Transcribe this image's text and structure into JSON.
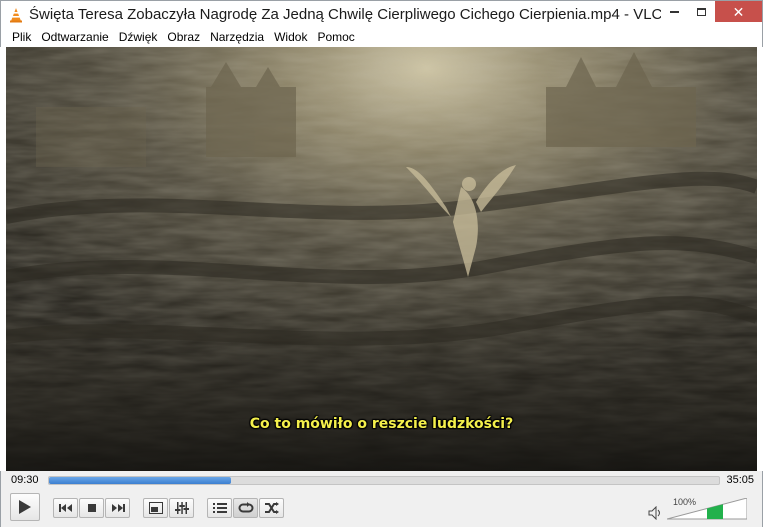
{
  "window": {
    "title": "Święta Teresa Zobaczyła Nagrodę Za Jedną Chwilę Cierpliwego Cichego Cierpienia.mp4 - VLC...",
    "app_icon": "vlc-cone-icon"
  },
  "menu": {
    "items": [
      "Plik",
      "Odtwarzanie",
      "Dźwięk",
      "Obraz",
      "Narzędzia",
      "Widok",
      "Pomoc"
    ]
  },
  "video": {
    "subtitle": "Co to mówiło o reszcie ludzkości?"
  },
  "playback": {
    "elapsed": "09:30",
    "total": "35:05",
    "progress": 0.271
  },
  "volume": {
    "label": "100%",
    "level": 1.0
  },
  "colors": {
    "subtitle": "#f4f04b",
    "seek_fill": "#3c7fd0",
    "volume_fill": "#22b14c",
    "close_button": "#c7504b"
  },
  "icons": [
    "play-icon",
    "previous-icon",
    "stop-icon",
    "next-icon",
    "fullscreen-icon",
    "extended-settings-icon",
    "playlist-icon",
    "loop-icon",
    "shuffle-icon",
    "speaker-icon"
  ]
}
